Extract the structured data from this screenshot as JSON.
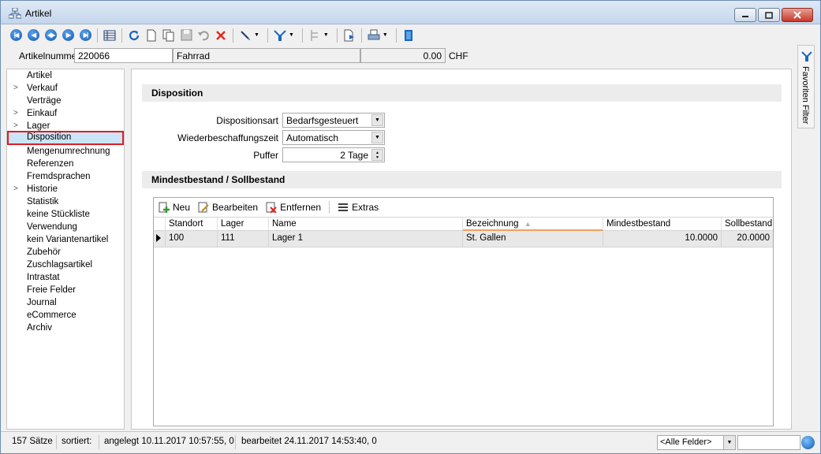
{
  "window": {
    "title": "Artikel"
  },
  "header": {
    "artikelnummer_label": "Artikelnummer",
    "artikelnummer_value": "220066",
    "description": "Fahrrad",
    "price": "0.00",
    "currency": "CHF"
  },
  "sidebar": {
    "items": [
      {
        "label": "Artikel",
        "chevron": false
      },
      {
        "label": "Verkauf",
        "chevron": true
      },
      {
        "label": "Verträge",
        "chevron": false
      },
      {
        "label": "Einkauf",
        "chevron": true
      },
      {
        "label": "Lager",
        "chevron": true
      },
      {
        "label": "Disposition",
        "chevron": false,
        "selected": true
      },
      {
        "label": "Mengenumrechnung",
        "chevron": false
      },
      {
        "label": "Referenzen",
        "chevron": false
      },
      {
        "label": "Fremdsprachen",
        "chevron": false
      },
      {
        "label": "Historie",
        "chevron": true
      },
      {
        "label": "Statistik",
        "chevron": false
      },
      {
        "label": "keine Stückliste",
        "chevron": false
      },
      {
        "label": "Verwendung",
        "chevron": false
      },
      {
        "label": "kein Variantenartikel",
        "chevron": false
      },
      {
        "label": "Zubehör",
        "chevron": false
      },
      {
        "label": "Zuschlagsartikel",
        "chevron": false
      },
      {
        "label": "Intrastat",
        "chevron": false
      },
      {
        "label": "Freie Felder",
        "chevron": false
      },
      {
        "label": "Journal",
        "chevron": false
      },
      {
        "label": "eCommerce",
        "chevron": false
      },
      {
        "label": "Archiv",
        "chevron": false
      }
    ]
  },
  "disposition": {
    "section_title": "Disposition",
    "dispositionsart_label": "Dispositionsart",
    "dispositionsart_value": "Bedarfsgesteuert",
    "wiederbeschaffungszeit_label": "Wiederbeschaffungszeit",
    "wiederbeschaffungszeit_value": "Automatisch",
    "puffer_label": "Puffer",
    "puffer_value": "2 Tage"
  },
  "bestand": {
    "section_title": "Mindestbestand / Sollbestand",
    "toolbar": {
      "neu": "Neu",
      "bearbeiten": "Bearbeiten",
      "entfernen": "Entfernen",
      "extras": "Extras"
    },
    "columns": [
      "Standort",
      "Lager",
      "Name",
      "Bezeichnung",
      "Mindestbestand",
      "Sollbestand"
    ],
    "rows": [
      {
        "standort": "100",
        "lager": "111",
        "name": "Lager 1",
        "bezeichnung": "St. Gallen",
        "mindestbestand": "10.0000",
        "sollbestand": "20.0000"
      }
    ]
  },
  "right_panel": {
    "label": "Favoriten Filter"
  },
  "status": {
    "count": "157 Sätze",
    "sorted": "sortiert:",
    "created": "angelegt 10.11.2017 10:57:55,  0",
    "edited": "bearbeitet 24.11.2017 14:53:40,  0",
    "field_filter": "<Alle Felder>"
  },
  "colors": {
    "selection_border": "#e31b23",
    "accent_blue": "#1257b4",
    "sort_underline": "#f0a060"
  }
}
